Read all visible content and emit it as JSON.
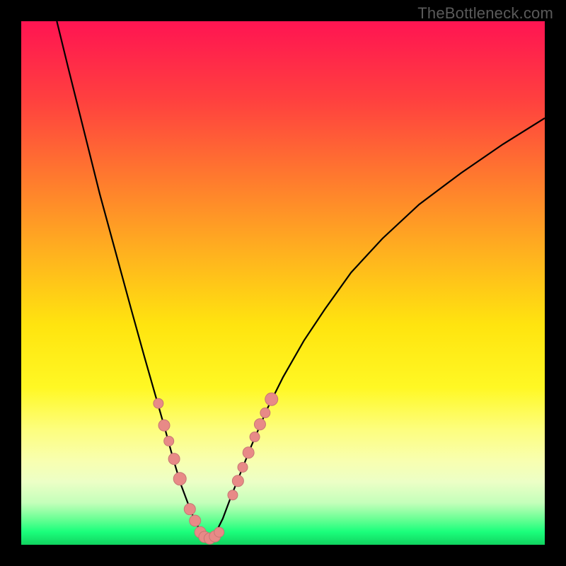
{
  "watermark": "TheBottleneck.com",
  "colors": {
    "frame": "#000000",
    "curve": "#000000",
    "marker_fill": "#e88a87",
    "marker_stroke": "#c67773",
    "gradient_top": "#ff1452",
    "gradient_bottom": "#11d35f"
  },
  "chart_data": {
    "type": "line",
    "title": "",
    "xlabel": "",
    "ylabel": "",
    "xlim": [
      0,
      100
    ],
    "ylim": [
      0,
      100
    ],
    "grid": false,
    "legend": false,
    "series": [
      {
        "name": "left_curve",
        "x": [
          6.8,
          9,
          12,
          15,
          18,
          21,
          23.5,
          25.5,
          27.5,
          29,
          30.5,
          32,
          33,
          34,
          35,
          35.8
        ],
        "y": [
          100,
          91,
          79,
          67,
          56,
          45,
          36,
          29,
          22,
          16.5,
          11.5,
          7.5,
          5,
          3,
          1.5,
          0.7
        ]
      },
      {
        "name": "right_curve",
        "x": [
          35.8,
          37,
          38.5,
          40,
          42,
          44,
          47,
          50,
          54,
          58,
          63,
          69,
          76,
          84,
          92,
          100
        ],
        "y": [
          0.7,
          2,
          5,
          9,
          14,
          19,
          26,
          32,
          39,
          45,
          52,
          58.5,
          65,
          71,
          76.5,
          81.5
        ]
      }
    ],
    "markers_left": [
      {
        "x": 26.2,
        "y": 27.0,
        "r": 7
      },
      {
        "x": 27.3,
        "y": 22.8,
        "r": 8
      },
      {
        "x": 28.2,
        "y": 19.8,
        "r": 7
      },
      {
        "x": 29.2,
        "y": 16.4,
        "r": 8
      },
      {
        "x": 30.3,
        "y": 12.6,
        "r": 9
      },
      {
        "x": 32.2,
        "y": 6.8,
        "r": 8
      },
      {
        "x": 33.2,
        "y": 4.6,
        "r": 8
      },
      {
        "x": 34.2,
        "y": 2.4,
        "r": 8
      },
      {
        "x": 35.0,
        "y": 1.5,
        "r": 8
      },
      {
        "x": 36.0,
        "y": 1.2,
        "r": 8
      },
      {
        "x": 37.0,
        "y": 1.6,
        "r": 8
      },
      {
        "x": 37.8,
        "y": 2.4,
        "r": 7
      }
    ],
    "markers_right": [
      {
        "x": 40.4,
        "y": 9.5,
        "r": 7
      },
      {
        "x": 41.4,
        "y": 12.2,
        "r": 8
      },
      {
        "x": 42.3,
        "y": 14.8,
        "r": 7
      },
      {
        "x": 43.4,
        "y": 17.6,
        "r": 8
      },
      {
        "x": 44.6,
        "y": 20.6,
        "r": 7
      },
      {
        "x": 45.6,
        "y": 23.0,
        "r": 8
      },
      {
        "x": 46.6,
        "y": 25.2,
        "r": 7
      },
      {
        "x": 47.8,
        "y": 27.8,
        "r": 9
      }
    ]
  }
}
